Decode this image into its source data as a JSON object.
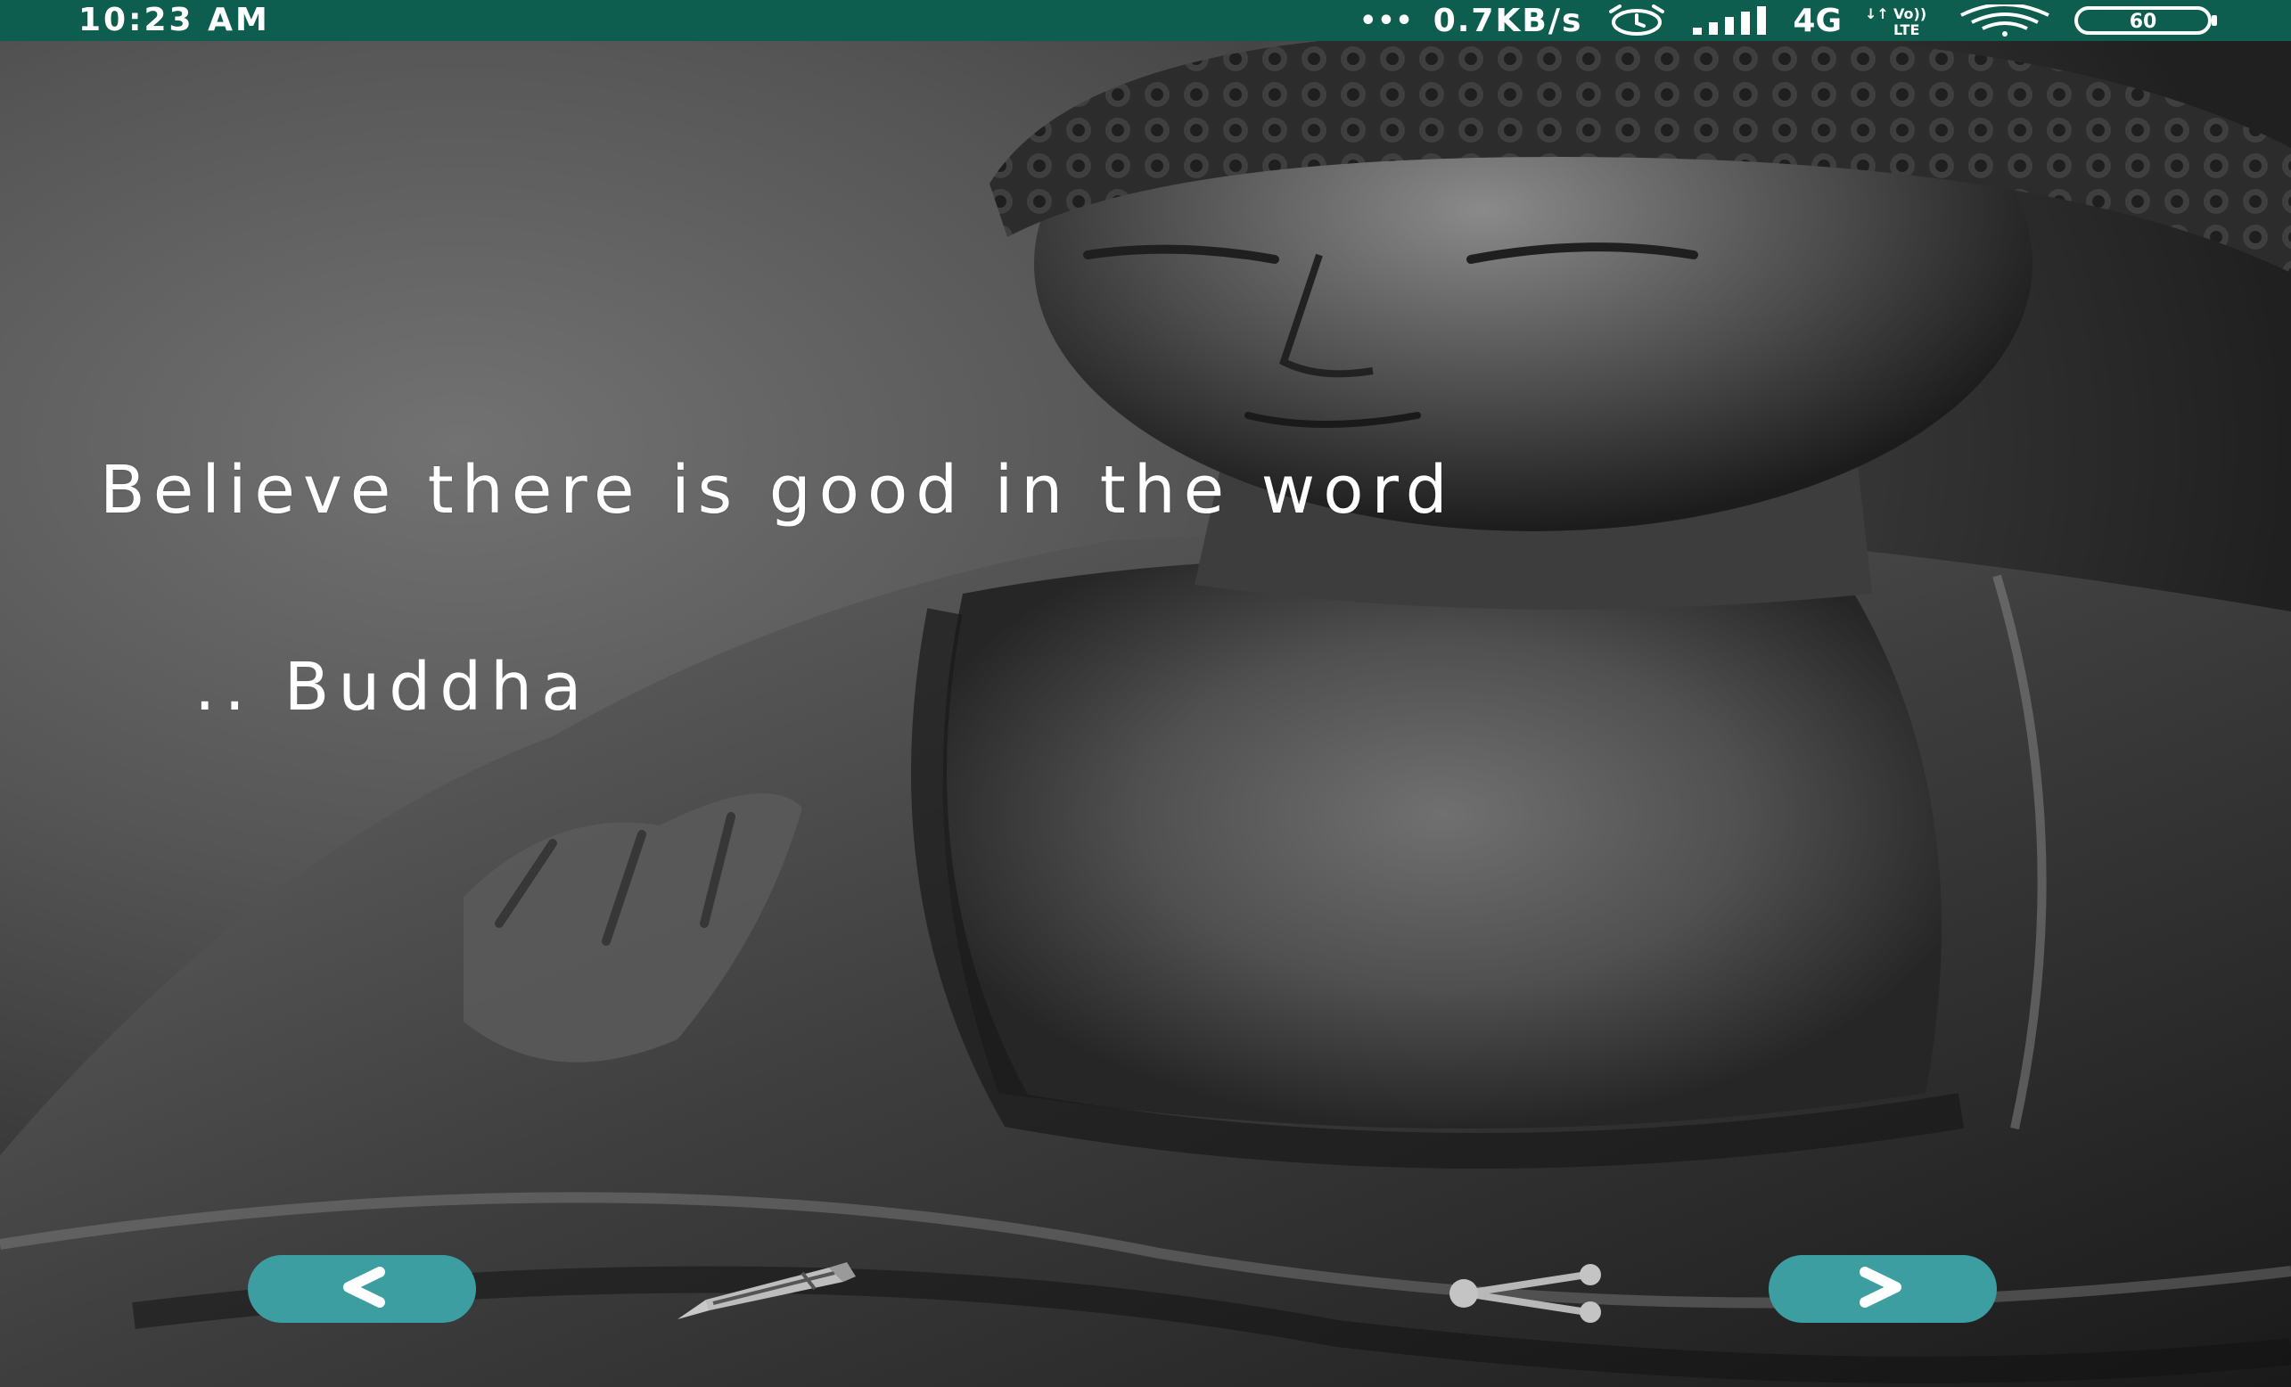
{
  "status_bar": {
    "time": "10:23 AM",
    "dots": "•••",
    "net_speed": "0.7KB/s",
    "network_type": "4G",
    "volte_label": "Vo)) LTE",
    "battery_level": "60",
    "icons": [
      "alarm-icon",
      "signal-icon",
      "volte-icon",
      "wifi-icon",
      "battery-icon"
    ],
    "background_color": "#0e5e4f"
  },
  "quote": {
    "text": "Believe there is good in the word",
    "author": ".. Buddha"
  },
  "toolbar": {
    "prev_icon": "chevron-left-icon",
    "edit_icon": "pencil-icon",
    "share_icon": "share-icon",
    "next_icon": "chevron-right-icon",
    "button_color": "#3d9ea2"
  }
}
